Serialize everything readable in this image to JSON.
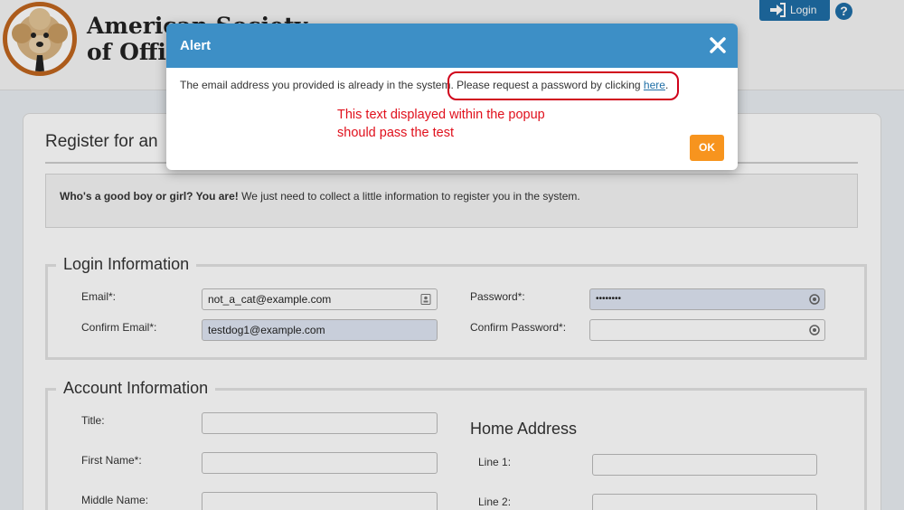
{
  "header": {
    "org_name_line1": "American Society",
    "org_name_line2": "of Offi",
    "login_label": "Login",
    "help_label": "?"
  },
  "form": {
    "title": "Register for an",
    "intro_bold": "Who's a good boy or girl? You are!",
    "intro_text": " We just need to collect a little information to register you in the system.",
    "login_section": {
      "legend": "Login Information",
      "email_label": "Email*:",
      "email_value": "not_a_cat@example.com",
      "confirm_email_label": "Confirm Email*:",
      "confirm_email_value": "testdog1@example.com",
      "password_label": "Password*:",
      "password_value": "••••••••",
      "confirm_password_label": "Confirm Password*:",
      "confirm_password_value": ""
    },
    "account_section": {
      "legend": "Account Information",
      "title_label": "Title:",
      "first_name_label": "First Name*:",
      "middle_name_label": "Middle Name:",
      "home_address_title": "Home Address",
      "line1_label": "Line 1:",
      "line2_label": "Line 2:"
    }
  },
  "modal": {
    "title": "Alert",
    "message_start": "The email address you provided is already in the system. Please request a password by clicking ",
    "link_text": "here",
    "message_end": ".",
    "ok_label": "OK",
    "annotation_line1": "This text displayed within the popup",
    "annotation_line2": "should pass the test"
  },
  "colors": {
    "modal_header": "#3d8fc6",
    "ok_button": "#f7941e",
    "annotation": "#e0101c",
    "brand_blue": "#1f6ea6"
  },
  "icons": [
    "dog-logo-icon",
    "login-arrow-icon",
    "help-icon",
    "close-icon",
    "contact-card-icon",
    "password-reveal-icon"
  ]
}
